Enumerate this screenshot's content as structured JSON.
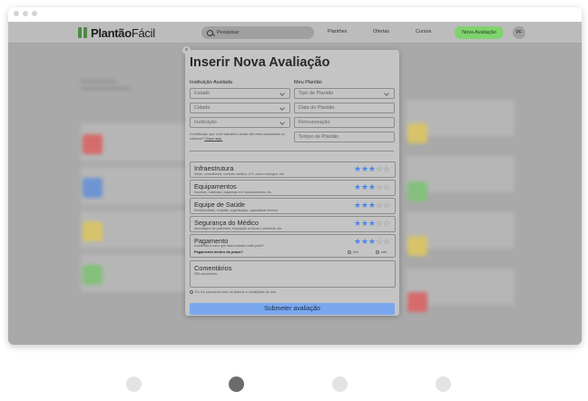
{
  "app": {
    "logo_bold": "Plantão",
    "logo_light": "Fácil",
    "search_placeholder": "Pesquisar",
    "nav": [
      "Plantões",
      "Ofertas",
      "Cursos"
    ],
    "cta": "Nova Avaliação",
    "avatar_initials": "PF"
  },
  "modal": {
    "title": "Inserir Nova Avaliação",
    "left_label": "Instituição Avaliada",
    "right_label": "Meu Plantão",
    "left_fields": [
      "Estado",
      "Cidade",
      "Instituição"
    ],
    "right_fields": [
      "Tipo de Plantão",
      "Data do Plantão",
      "Remuneração",
      "Tempo de Plantão"
    ],
    "note_text": "A instituição que você trabalhou ainda não está cadastrada no sistema?",
    "note_link": "Clique aqui.",
    "ratings": [
      {
        "title": "Infraestrutura",
        "subtitle": "Salas, consultórios, conforto médico, UTI, centro cirúrgico, etc.",
        "stars": 3
      },
      {
        "title": "Equipamentos",
        "subtitle": "Insumos, materiais, máquinas em funcionamento, etc.",
        "stars": 3
      },
      {
        "title": "Equipe de Saúde",
        "subtitle": "Receptividade, empatia, organização, capacidade técnica",
        "stars": 3
      },
      {
        "title": "Segurança do Médico",
        "subtitle": "Abordagem de pacientes, exposição a riscos e violência, etc.",
        "stars": 3
      },
      {
        "title": "Pagamento",
        "subtitle": "",
        "stars": 3
      }
    ],
    "payment_question": "Incidência a valor que esse trabalho mais pede?",
    "payment_bold": "Pagamento dentro do prazo?",
    "payment_options": [
      "sim",
      "não"
    ],
    "comments_title": "Comentários",
    "comments_sub": "250 caracteres",
    "terms": "Eu li e concordo com os termos e condições de uso",
    "submit": "Submeter avaliação",
    "close": "×"
  },
  "colors": {
    "accent_green": "#7fd36e",
    "star_blue": "#4d86e6",
    "submit_blue": "#7aa8ef"
  },
  "pager": {
    "count": 4,
    "active_index": 1
  }
}
